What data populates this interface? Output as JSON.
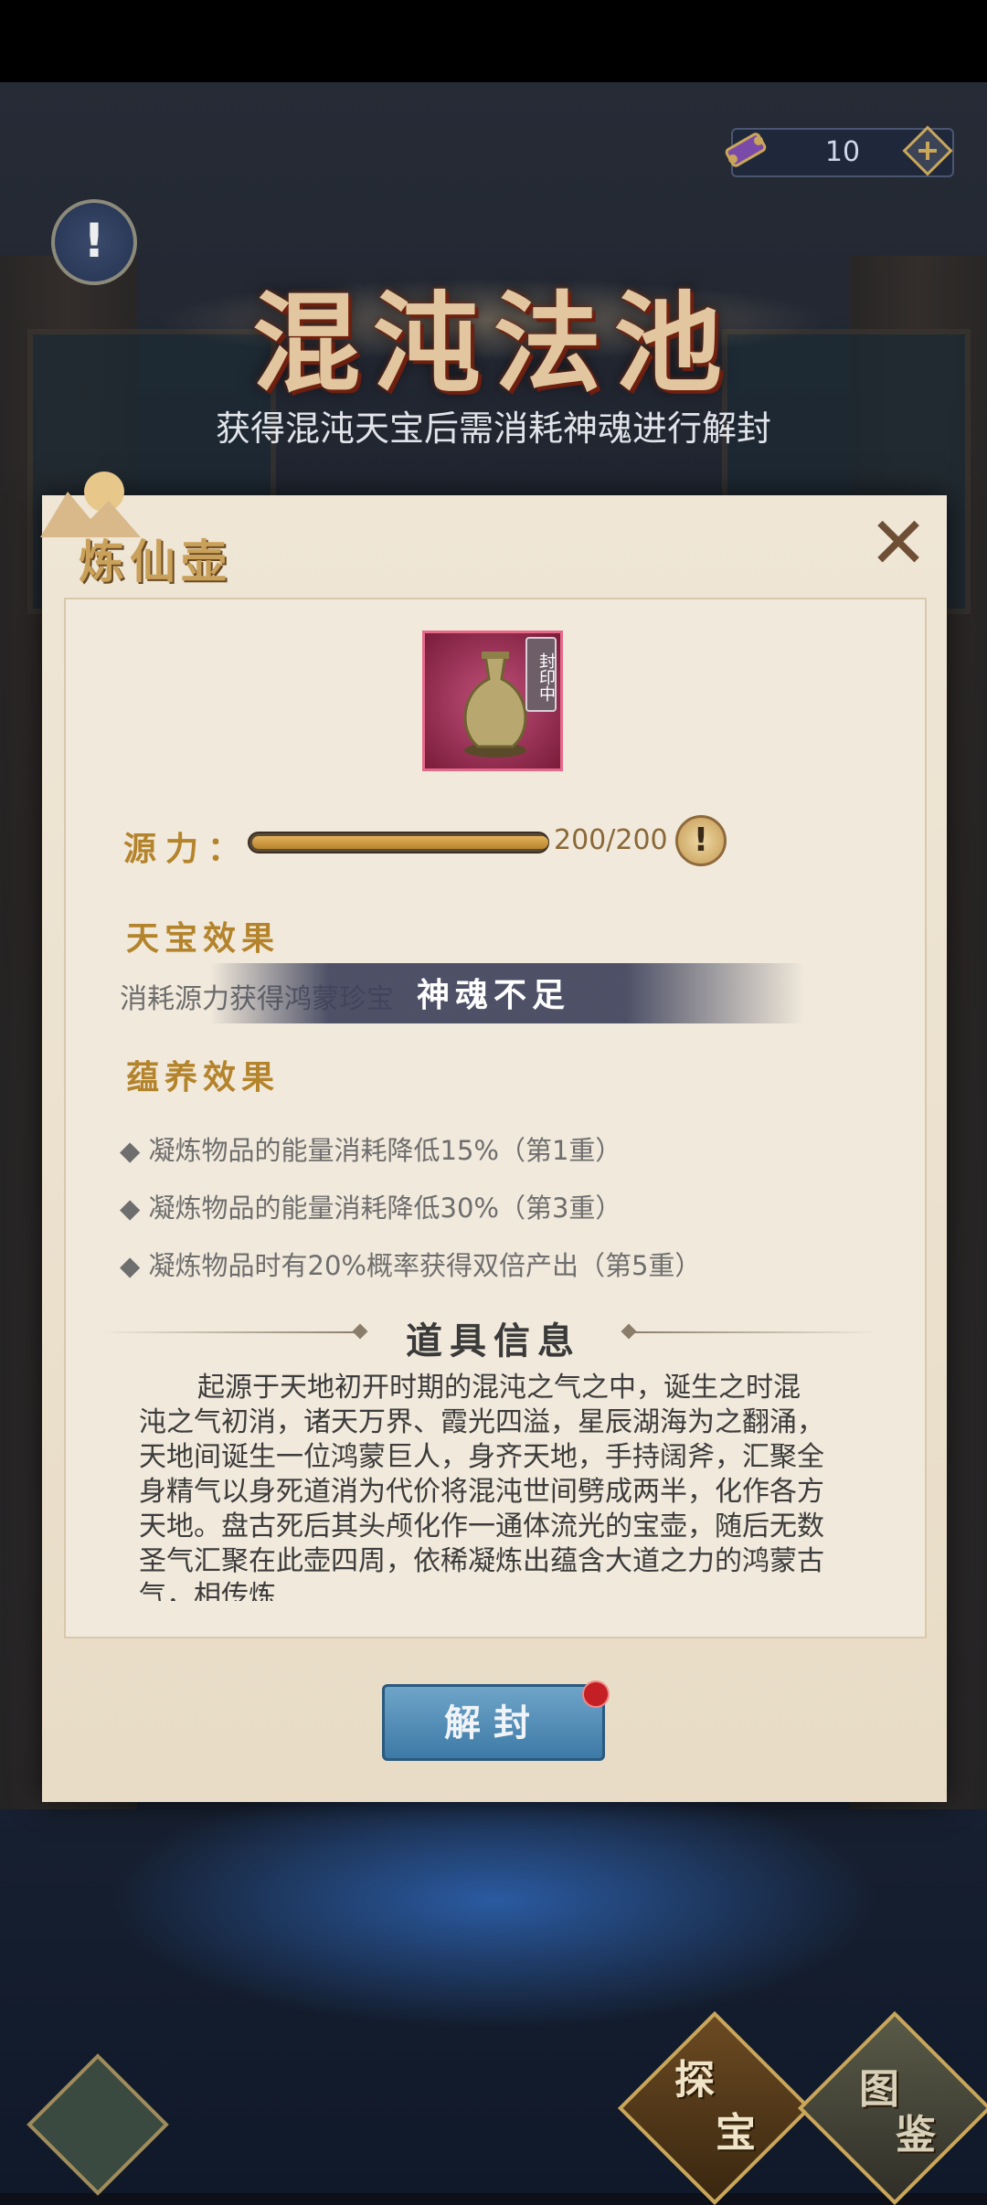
{
  "currency": {
    "value": "10"
  },
  "header": {
    "title": "混沌法池",
    "subtitle": "获得混沌天宝后需消耗神魂进行解封"
  },
  "dialog": {
    "title": "炼仙壶",
    "item_status": "封印中",
    "source_label": "源力：",
    "source_value": "200/200",
    "source_fraction": 1.0,
    "treasure_effect_head": "天宝效果",
    "treasure_effect_text": "消耗源力获得鸿蒙珍宝",
    "toast": "神魂不足",
    "nurture_head": "蕴养效果",
    "nurture_items": [
      "◆ 凝炼物品的能量消耗降低15%（第1重）",
      "◆ 凝炼物品的能量消耗降低30%（第3重）",
      "◆ 凝炼物品时有20%概率获得双倍产出（第5重）"
    ],
    "info_head": "道具信息",
    "description": "起源于天地初开时期的混沌之气之中，诞生之时混沌之气初消，诸天万界、霞光四溢，星辰湖海为之翻涌，天地间诞生一位鸿蒙巨人，身齐天地，手持阔斧，汇聚全身精气以身死道消为代价将混沌世间劈成两半，化作各方天地。盘古死后其头颅化作一通体流光的宝壶，随后无数圣气汇聚在此壶四周，依稀凝炼出蕴含大道之力的鸿蒙古气，相传炼",
    "unseal_button": "解封"
  },
  "nav": {
    "explore_a": "探",
    "explore_b": "宝",
    "atlas_a": "图",
    "atlas_b": "鉴"
  }
}
